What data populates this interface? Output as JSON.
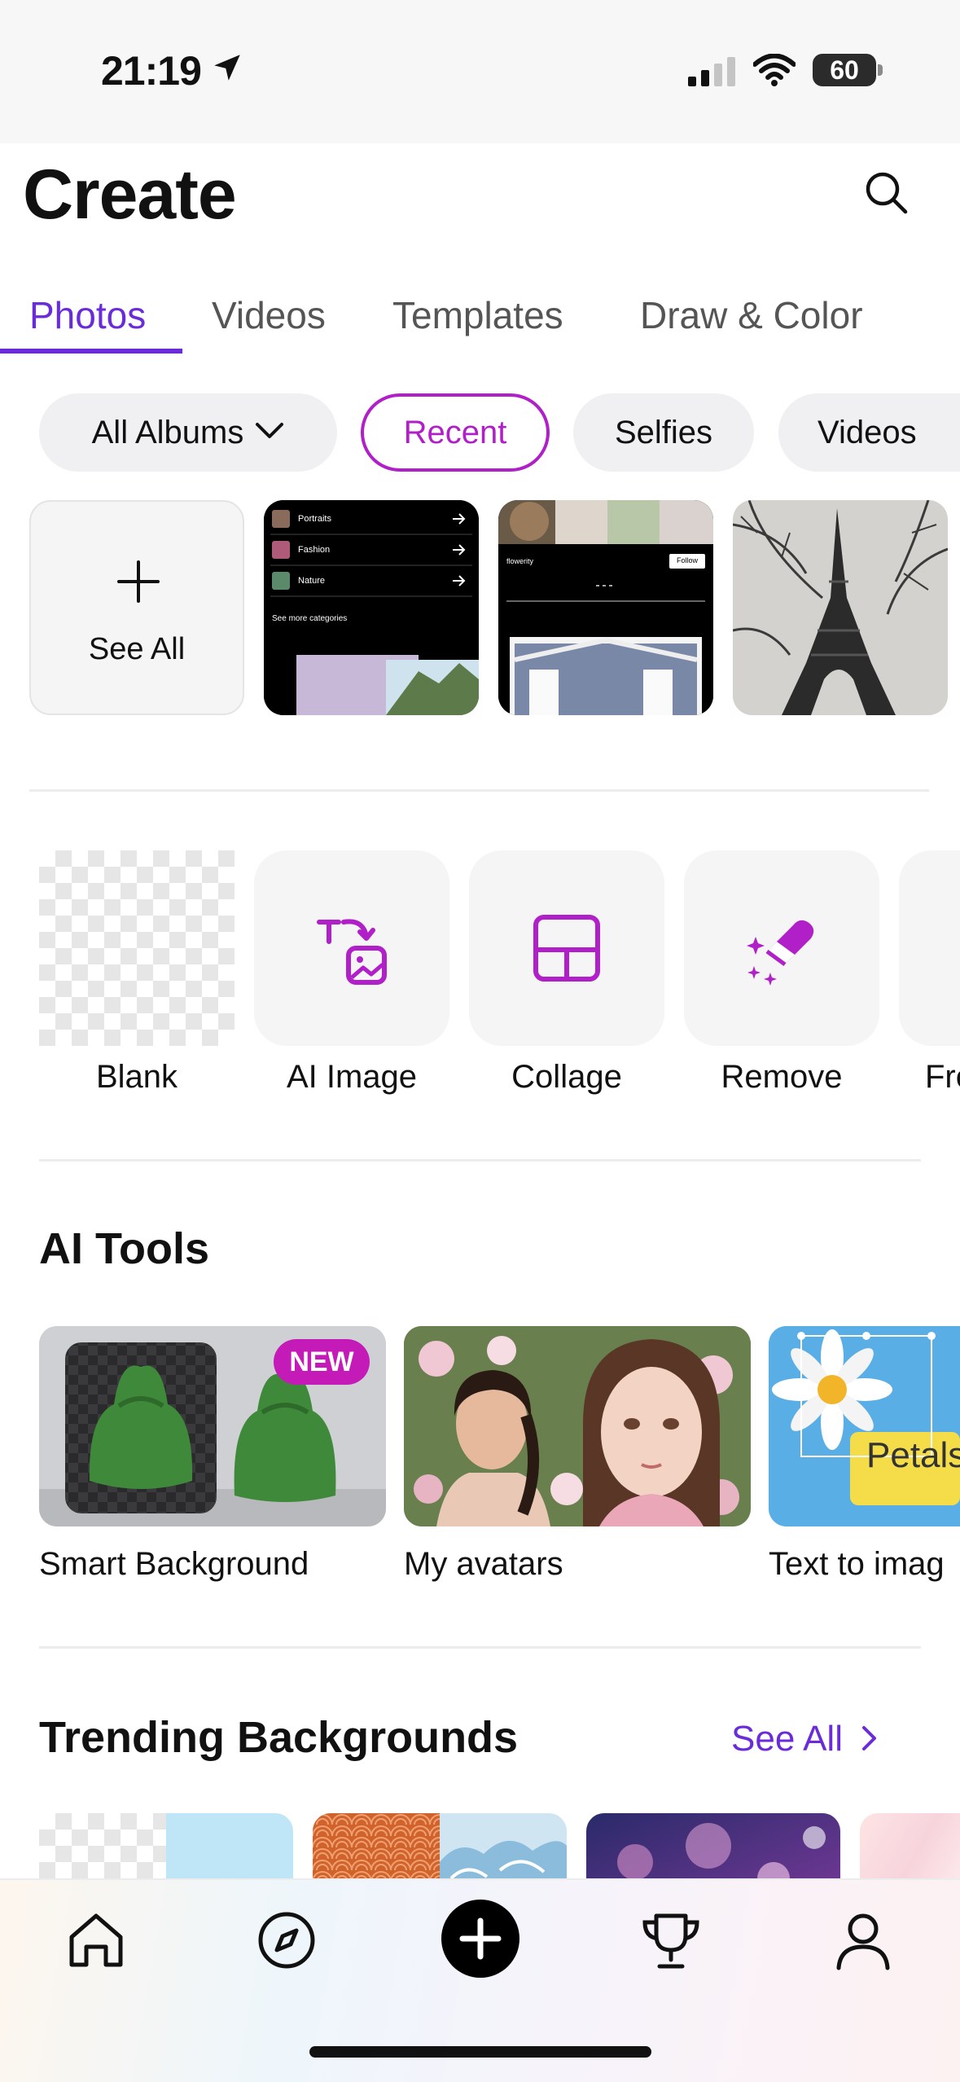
{
  "status_bar": {
    "time": "21:19",
    "battery": "60",
    "icons": [
      "location-arrow-icon",
      "cellular-signal-icon",
      "wifi-icon",
      "battery-icon"
    ]
  },
  "header": {
    "title": "Create",
    "search_icon": "search-icon"
  },
  "tabs": [
    {
      "label": "Photos",
      "active": true
    },
    {
      "label": "Videos"
    },
    {
      "label": "Templates"
    },
    {
      "label": "Draw & Color"
    }
  ],
  "filters": [
    {
      "label": "All Albums",
      "has_dropdown": true
    },
    {
      "label": "Recent",
      "active": true
    },
    {
      "label": "Selfies"
    },
    {
      "label": "Videos"
    }
  ],
  "recent": {
    "see_all": "See All",
    "thumb1": {
      "rows": [
        "Portraits",
        "Fashion",
        "Nature"
      ],
      "footer": "See more categories"
    },
    "thumb2": {
      "user": "flowerity",
      "follow": "Follow"
    }
  },
  "tools": [
    {
      "label": "Blank",
      "icon": "checkerboard"
    },
    {
      "label": "AI Image",
      "icon": "text-to-image-icon"
    },
    {
      "label": "Collage",
      "icon": "collage-icon"
    },
    {
      "label": "Remove",
      "icon": "eraser-sparkle-icon"
    },
    {
      "label": "Fre"
    }
  ],
  "ai_tools": {
    "title": "AI Tools",
    "items": [
      {
        "label": "Smart Background",
        "badge": "NEW"
      },
      {
        "label": "My avatars"
      },
      {
        "label": "Text to imag",
        "image_text": "Petals"
      }
    ]
  },
  "trending": {
    "title": "Trending Backgrounds",
    "see_all": "See All"
  },
  "colors": {
    "accent": "#6a2cd8",
    "magenta": "#b01fc7",
    "badge": "#c41ab8"
  },
  "bottom_nav": [
    "home-icon",
    "discover-compass-icon",
    "create-plus-icon",
    "trophy-icon",
    "profile-icon"
  ]
}
